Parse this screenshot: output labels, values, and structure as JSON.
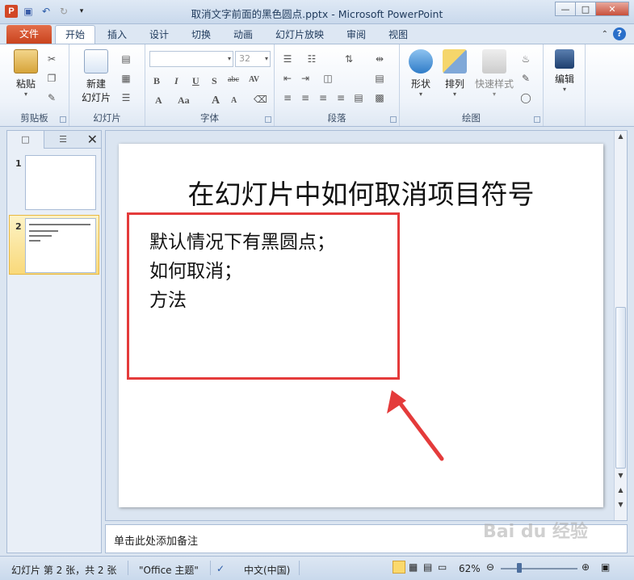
{
  "titlebar": {
    "app_logo": "P",
    "title": "取消文字前面的黑色圆点.pptx - Microsoft PowerPoint",
    "icons": [
      "save-icon",
      "undo-icon",
      "redo-icon",
      "customize-qat-icon"
    ]
  },
  "tabs": {
    "file": "文件",
    "items": [
      "开始",
      "插入",
      "设计",
      "切换",
      "动画",
      "幻灯片放映",
      "审阅",
      "视图"
    ],
    "active": "开始"
  },
  "ribbon": {
    "clipboard": {
      "label": "剪贴板",
      "paste": "粘贴"
    },
    "slides": {
      "label": "幻灯片",
      "new_slide_line1": "新建",
      "new_slide_line2": "幻灯片"
    },
    "font": {
      "label": "字体",
      "font_size": "32",
      "bold": "B",
      "italic": "I",
      "underline": "U",
      "shadow": "S",
      "strike": "abc",
      "spacing": "AV",
      "font_color": "A",
      "change_case": "Aa",
      "grow": "A",
      "shrink": "A"
    },
    "paragraph": {
      "label": "段落"
    },
    "drawing": {
      "label": "绘图",
      "shape": "形状",
      "arrange": "排列",
      "quick_styles": "快速样式"
    },
    "editing": {
      "label": "编辑",
      "edit": "编辑"
    }
  },
  "slides_pane": {
    "slides": [
      {
        "number": "1"
      },
      {
        "number": "2"
      }
    ]
  },
  "slide": {
    "title": "在幻灯片中如何取消项目符号",
    "lines": [
      "默认情况下有黑圆点；",
      "如何取消；",
      "方法"
    ]
  },
  "notes": {
    "placeholder": "单击此处添加备注"
  },
  "statusbar": {
    "slide_info": "幻灯片 第 2 张，共 2 张",
    "theme": "\"Office 主题\"",
    "language": "中文(中国)",
    "zoom": "62%"
  },
  "watermark": "Bai du 经验",
  "colors": {
    "highlight_box": "#e43b3b",
    "file_tab": "#d24726",
    "selected_thumb": "#f9d97a"
  }
}
